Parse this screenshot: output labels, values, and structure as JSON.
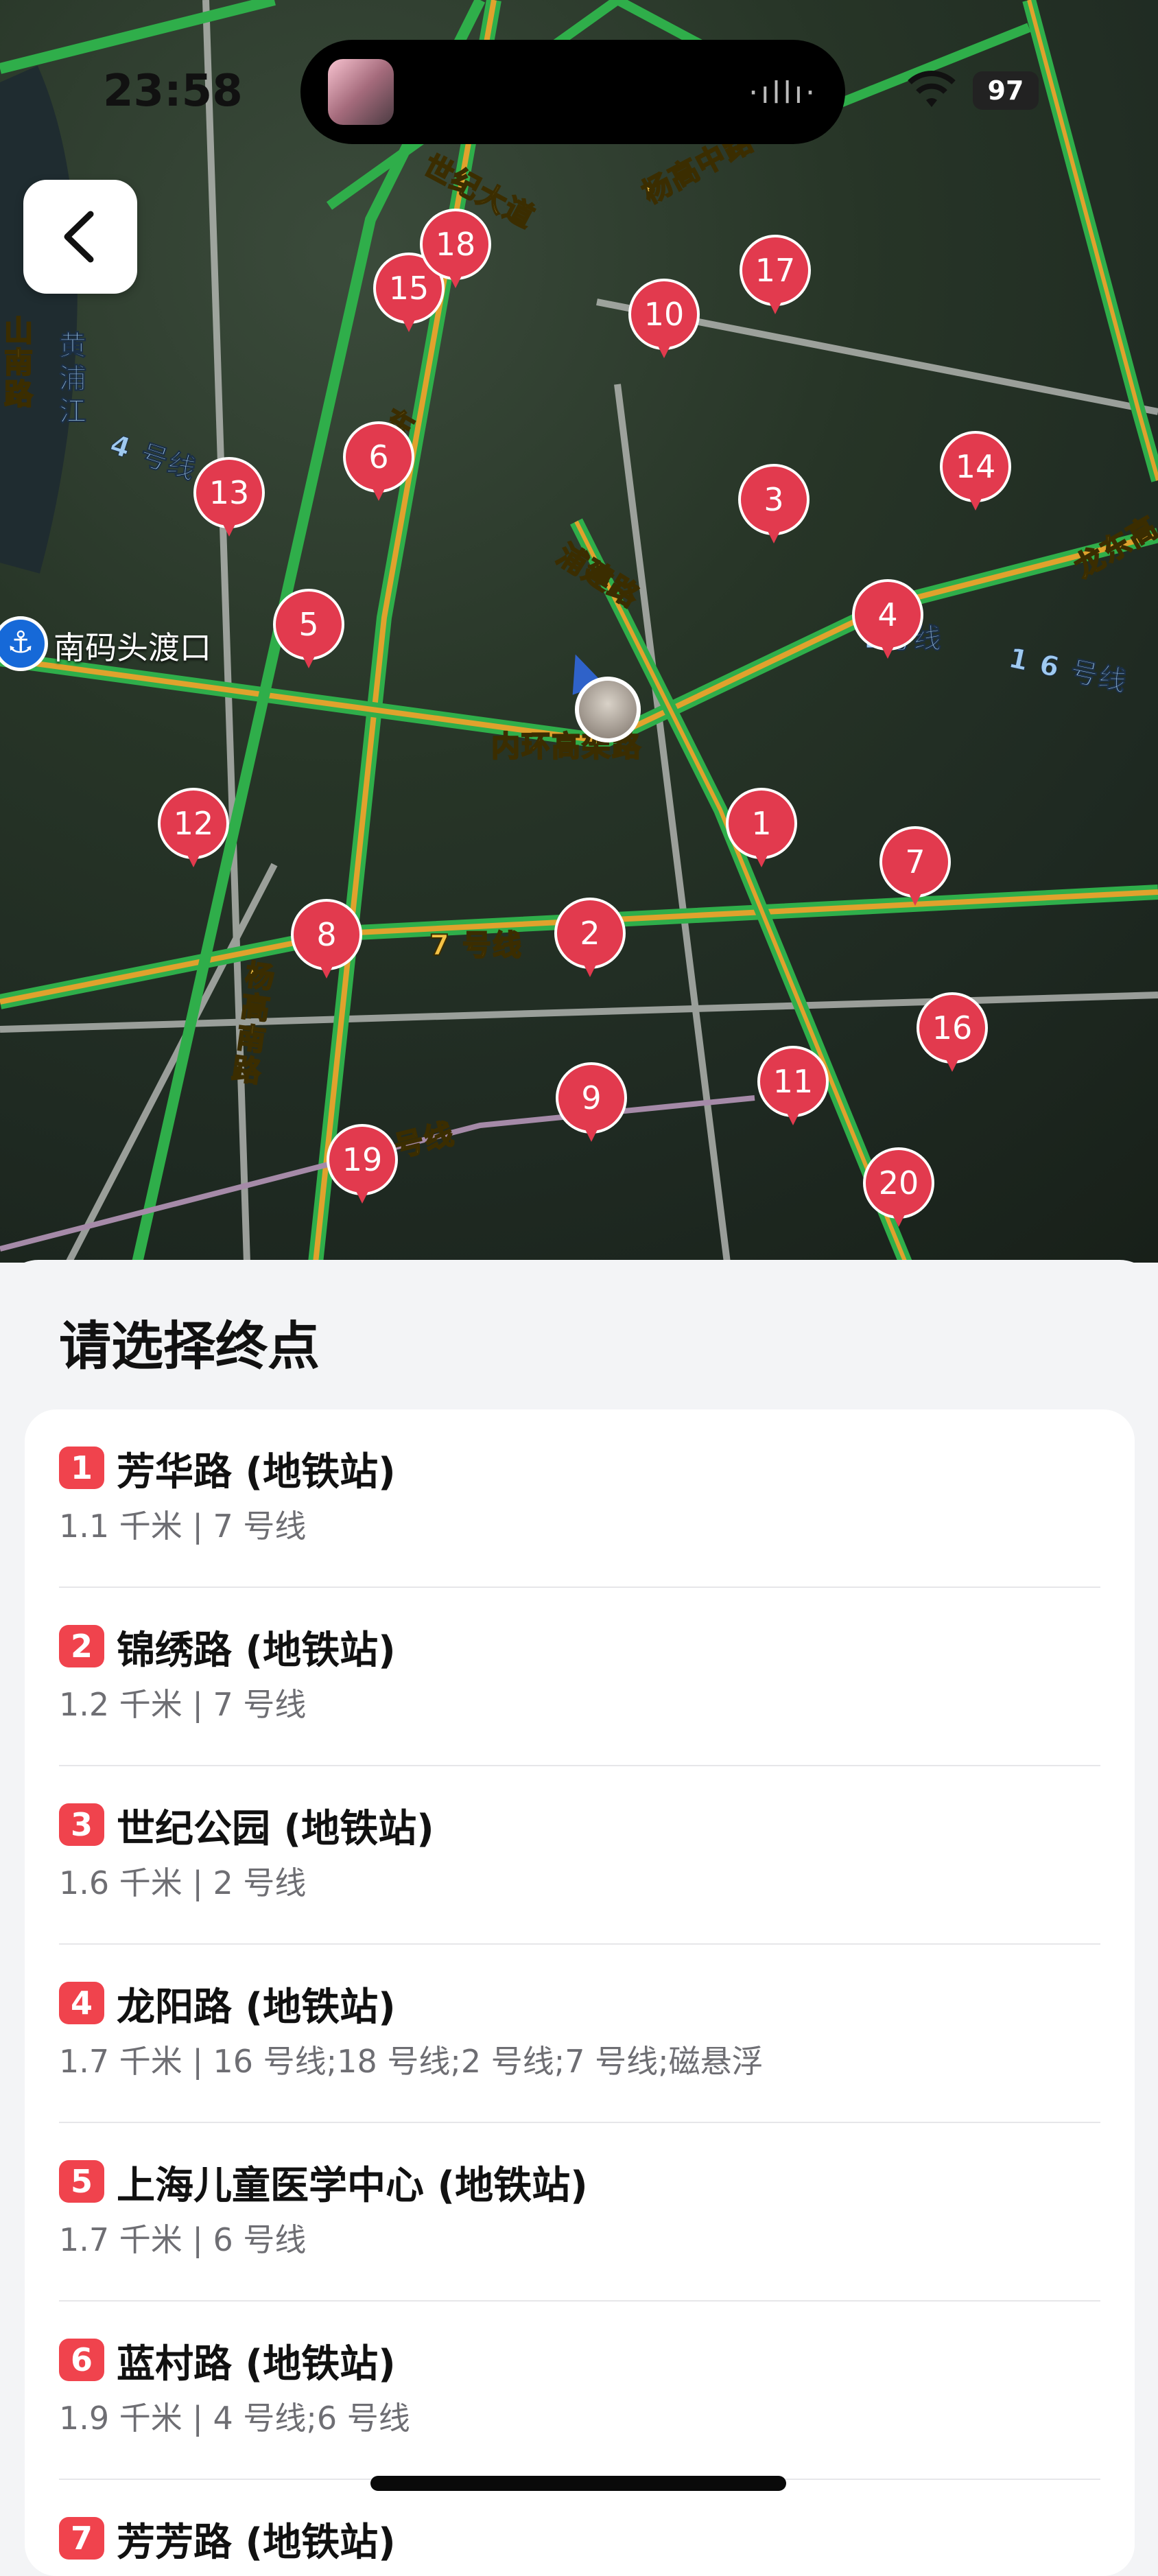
{
  "status_bar": {
    "time": "23:58",
    "battery": "97"
  },
  "map": {
    "labels": {
      "century_avenue": "世纪大道",
      "yanggao_mid": "杨高中路",
      "huangpu_river": "黄浦江",
      "line4": "4 号线",
      "pujian_rd": "浦建路",
      "inner_ring": "内环高架路",
      "line7": "7 号线",
      "yanggao_south": "杨高南路",
      "line9": "号线",
      "line16": "1 6 号线",
      "longdong": "龙东高",
      "line2": "2号线",
      "dongdong": "东",
      "road_left": "山南路"
    },
    "ferry": {
      "icon": "anchor-icon",
      "label": "南码头渡口"
    },
    "pins": [
      "1",
      "2",
      "3",
      "4",
      "5",
      "6",
      "7",
      "8",
      "9",
      "10",
      "11",
      "12",
      "13",
      "14",
      "15",
      "16",
      "17",
      "18",
      "19",
      "20"
    ],
    "pin_color": "#e23a4e"
  },
  "sheet": {
    "title": "请选择终点",
    "items": [
      {
        "num": "1",
        "name": "芳华路 (地铁站)",
        "sub": "1.1 千米 | 7 号线"
      },
      {
        "num": "2",
        "name": "锦绣路 (地铁站)",
        "sub": "1.2 千米 | 7 号线"
      },
      {
        "num": "3",
        "name": "世纪公园 (地铁站)",
        "sub": "1.6 千米 | 2 号线"
      },
      {
        "num": "4",
        "name": "龙阳路 (地铁站)",
        "sub": "1.7 千米 | 16 号线;18 号线;2 号线;7 号线;磁悬浮"
      },
      {
        "num": "5",
        "name": "上海儿童医学中心 (地铁站)",
        "sub": "1.7 千米 | 6 号线"
      },
      {
        "num": "6",
        "name": "蓝村路 (地铁站)",
        "sub": "1.9 千米 | 4 号线;6 号线"
      },
      {
        "num": "7",
        "name": "芳芳路 (地铁站)",
        "sub": ""
      }
    ]
  }
}
